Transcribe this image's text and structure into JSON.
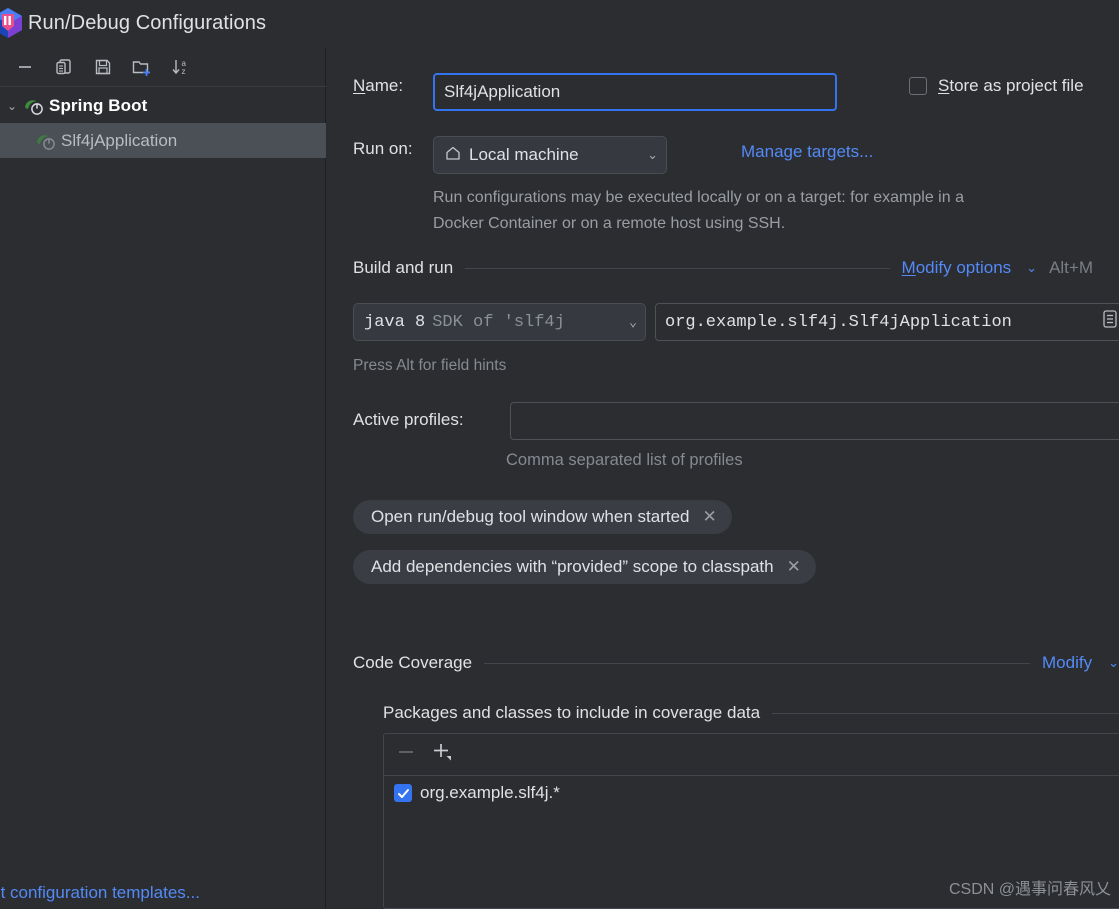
{
  "window": {
    "title": "Run/Debug Configurations",
    "logo_icon": "intellij-idea-logo"
  },
  "sidebar": {
    "toolbar": [
      {
        "name": "remove-configuration-button",
        "icon": "minus-icon",
        "label": "—"
      },
      {
        "name": "copy-configuration-button",
        "icon": "copy-icon",
        "label": "Copy"
      },
      {
        "name": "save-configuration-button",
        "icon": "save-icon",
        "label": "Save"
      },
      {
        "name": "new-folder-button",
        "icon": "folder-plus-icon",
        "label": "New Folder"
      },
      {
        "name": "sort-configurations-button",
        "icon": "sort-alpha-icon",
        "label": "Sort"
      }
    ],
    "tree": [
      {
        "label": "Spring Boot",
        "icon": "spring-boot-icon",
        "type": "group",
        "expanded": true
      },
      {
        "label": "Slf4jApplication",
        "icon": "spring-boot-icon",
        "type": "child",
        "selected": true
      }
    ],
    "edit_templates_link": "Edit configuration templates..."
  },
  "form": {
    "name_label": "Name:",
    "name_mnemonic": "N",
    "name_value": "Slf4jApplication",
    "store_as_project_file_label": "Store as project file",
    "store_as_project_file_mnemonic": "S",
    "store_as_project_file_checked": false,
    "run_on_label": "Run on:",
    "run_on_value": "Local machine",
    "run_on_icon": "home-icon",
    "manage_targets_link": "Manage targets...",
    "targets_description": "Run configurations may be executed locally or on a target: for example in a Docker Container or on a remote host using SSH."
  },
  "build_and_run": {
    "section_title": "Build and run",
    "modify_options_link": "Modify options",
    "modify_options_mnemonic": "M",
    "modify_options_shortcut": "Alt+M",
    "jdk_value": "java 8",
    "jdk_secondary": "SDK of 'slf4j",
    "main_class_value": "org.example.slf4j.Slf4jApplication",
    "main_class_browse_icon": "list-browse-icon",
    "field_hint": "Press Alt for field hints",
    "active_profiles_label": "Active profiles:",
    "active_profiles_value": "",
    "active_profiles_hint": "Comma separated list of profiles",
    "chips": [
      {
        "label": "Open run/debug tool window when started",
        "close_icon": "close-icon"
      },
      {
        "label": "Add dependencies with “provided” scope to classpath",
        "close_icon": "close-icon"
      }
    ]
  },
  "code_coverage": {
    "section_title": "Code Coverage",
    "modify_link": "Modify",
    "subsection_title": "Packages and classes to include in coverage data",
    "toolbar": [
      {
        "name": "remove-package-button",
        "icon": "minus-icon",
        "enabled": false
      },
      {
        "name": "add-package-button",
        "icon": "plus-dropdown-icon",
        "enabled": true
      }
    ],
    "items": [
      {
        "label": "org.example.slf4j.*",
        "checked": true
      }
    ]
  },
  "watermark": "CSDN @遇事问春风乂",
  "colors": {
    "background": "#2b2d30",
    "accent_blue": "#3574f0",
    "link_blue": "#548af7",
    "highlight_red": "#f24236",
    "spring_green": "#3d8b3d",
    "selection": "#4b4f56"
  }
}
